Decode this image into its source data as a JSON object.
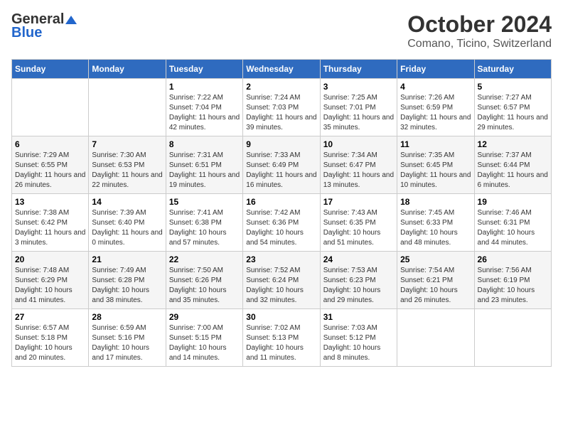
{
  "logo": {
    "general": "General",
    "blue": "Blue"
  },
  "header": {
    "month": "October 2024",
    "location": "Comano, Ticino, Switzerland"
  },
  "days_of_week": [
    "Sunday",
    "Monday",
    "Tuesday",
    "Wednesday",
    "Thursday",
    "Friday",
    "Saturday"
  ],
  "weeks": [
    [
      {
        "day": "",
        "info": ""
      },
      {
        "day": "",
        "info": ""
      },
      {
        "day": "1",
        "sunrise": "7:22 AM",
        "sunset": "7:04 PM",
        "daylight": "11 hours and 42 minutes."
      },
      {
        "day": "2",
        "sunrise": "7:24 AM",
        "sunset": "7:03 PM",
        "daylight": "11 hours and 39 minutes."
      },
      {
        "day": "3",
        "sunrise": "7:25 AM",
        "sunset": "7:01 PM",
        "daylight": "11 hours and 35 minutes."
      },
      {
        "day": "4",
        "sunrise": "7:26 AM",
        "sunset": "6:59 PM",
        "daylight": "11 hours and 32 minutes."
      },
      {
        "day": "5",
        "sunrise": "7:27 AM",
        "sunset": "6:57 PM",
        "daylight": "11 hours and 29 minutes."
      }
    ],
    [
      {
        "day": "6",
        "sunrise": "7:29 AM",
        "sunset": "6:55 PM",
        "daylight": "11 hours and 26 minutes."
      },
      {
        "day": "7",
        "sunrise": "7:30 AM",
        "sunset": "6:53 PM",
        "daylight": "11 hours and 22 minutes."
      },
      {
        "day": "8",
        "sunrise": "7:31 AM",
        "sunset": "6:51 PM",
        "daylight": "11 hours and 19 minutes."
      },
      {
        "day": "9",
        "sunrise": "7:33 AM",
        "sunset": "6:49 PM",
        "daylight": "11 hours and 16 minutes."
      },
      {
        "day": "10",
        "sunrise": "7:34 AM",
        "sunset": "6:47 PM",
        "daylight": "11 hours and 13 minutes."
      },
      {
        "day": "11",
        "sunrise": "7:35 AM",
        "sunset": "6:45 PM",
        "daylight": "11 hours and 10 minutes."
      },
      {
        "day": "12",
        "sunrise": "7:37 AM",
        "sunset": "6:44 PM",
        "daylight": "11 hours and 6 minutes."
      }
    ],
    [
      {
        "day": "13",
        "sunrise": "7:38 AM",
        "sunset": "6:42 PM",
        "daylight": "11 hours and 3 minutes."
      },
      {
        "day": "14",
        "sunrise": "7:39 AM",
        "sunset": "6:40 PM",
        "daylight": "11 hours and 0 minutes."
      },
      {
        "day": "15",
        "sunrise": "7:41 AM",
        "sunset": "6:38 PM",
        "daylight": "10 hours and 57 minutes."
      },
      {
        "day": "16",
        "sunrise": "7:42 AM",
        "sunset": "6:36 PM",
        "daylight": "10 hours and 54 minutes."
      },
      {
        "day": "17",
        "sunrise": "7:43 AM",
        "sunset": "6:35 PM",
        "daylight": "10 hours and 51 minutes."
      },
      {
        "day": "18",
        "sunrise": "7:45 AM",
        "sunset": "6:33 PM",
        "daylight": "10 hours and 48 minutes."
      },
      {
        "day": "19",
        "sunrise": "7:46 AM",
        "sunset": "6:31 PM",
        "daylight": "10 hours and 44 minutes."
      }
    ],
    [
      {
        "day": "20",
        "sunrise": "7:48 AM",
        "sunset": "6:29 PM",
        "daylight": "10 hours and 41 minutes."
      },
      {
        "day": "21",
        "sunrise": "7:49 AM",
        "sunset": "6:28 PM",
        "daylight": "10 hours and 38 minutes."
      },
      {
        "day": "22",
        "sunrise": "7:50 AM",
        "sunset": "6:26 PM",
        "daylight": "10 hours and 35 minutes."
      },
      {
        "day": "23",
        "sunrise": "7:52 AM",
        "sunset": "6:24 PM",
        "daylight": "10 hours and 32 minutes."
      },
      {
        "day": "24",
        "sunrise": "7:53 AM",
        "sunset": "6:23 PM",
        "daylight": "10 hours and 29 minutes."
      },
      {
        "day": "25",
        "sunrise": "7:54 AM",
        "sunset": "6:21 PM",
        "daylight": "10 hours and 26 minutes."
      },
      {
        "day": "26",
        "sunrise": "7:56 AM",
        "sunset": "6:19 PM",
        "daylight": "10 hours and 23 minutes."
      }
    ],
    [
      {
        "day": "27",
        "sunrise": "6:57 AM",
        "sunset": "5:18 PM",
        "daylight": "10 hours and 20 minutes."
      },
      {
        "day": "28",
        "sunrise": "6:59 AM",
        "sunset": "5:16 PM",
        "daylight": "10 hours and 17 minutes."
      },
      {
        "day": "29",
        "sunrise": "7:00 AM",
        "sunset": "5:15 PM",
        "daylight": "10 hours and 14 minutes."
      },
      {
        "day": "30",
        "sunrise": "7:02 AM",
        "sunset": "5:13 PM",
        "daylight": "10 hours and 11 minutes."
      },
      {
        "day": "31",
        "sunrise": "7:03 AM",
        "sunset": "5:12 PM",
        "daylight": "10 hours and 8 minutes."
      },
      {
        "day": "",
        "info": ""
      },
      {
        "day": "",
        "info": ""
      }
    ]
  ],
  "labels": {
    "sunrise": "Sunrise:",
    "sunset": "Sunset:",
    "daylight": "Daylight:"
  }
}
